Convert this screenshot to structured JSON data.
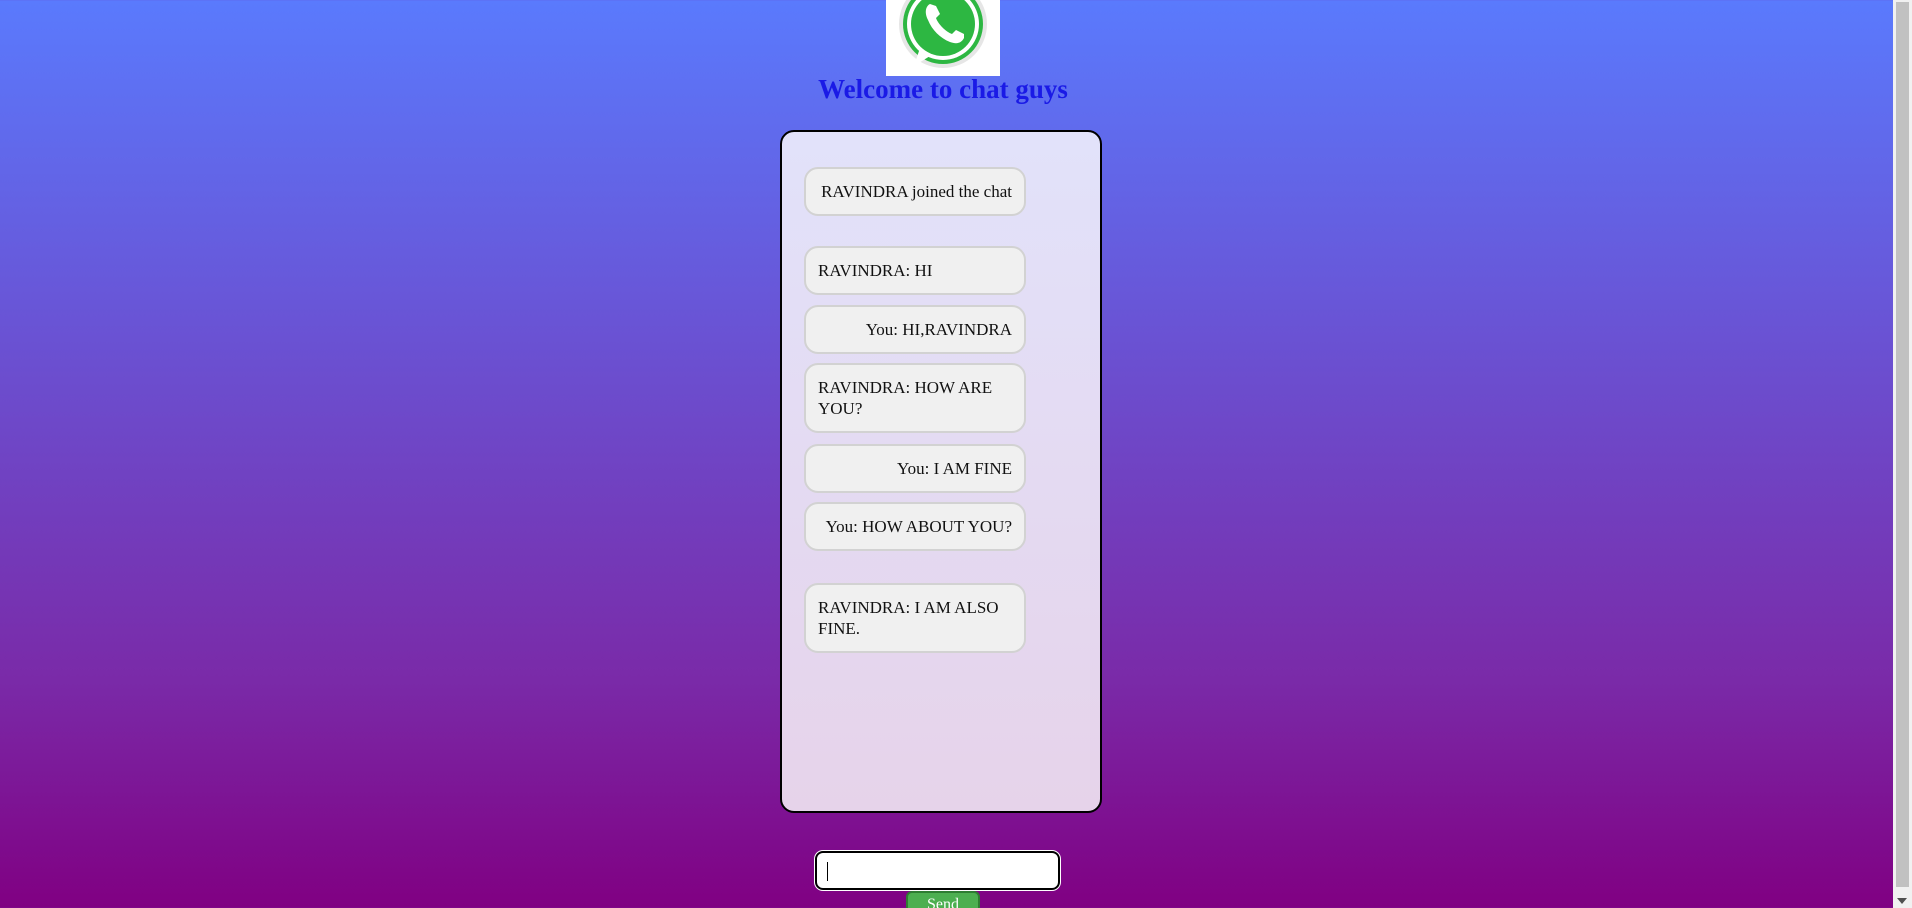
{
  "header": {
    "logo_icon": "whatsapp-icon",
    "title": "Welcome to chat guys"
  },
  "messages": [
    {
      "text": "RAVINDRA joined the chat",
      "align": "right"
    },
    {
      "text": "RAVINDRA: HI",
      "align": "left"
    },
    {
      "text": "You: HI,RAVINDRA",
      "align": "right"
    },
    {
      "text": "RAVINDRA: HOW ARE YOU?",
      "align": "left"
    },
    {
      "text": "You: I AM FINE",
      "align": "right"
    },
    {
      "text": "You: HOW ABOUT YOU?",
      "align": "right"
    },
    {
      "text": "RAVINDRA: I AM ALSO FINE.",
      "align": "left"
    }
  ],
  "composer": {
    "input_value": "",
    "send_label": "Send"
  },
  "colors": {
    "title": "#1a1ae6",
    "send_button": "#4caf50",
    "background_top": "#5a7afd",
    "background_bottom": "#800082"
  }
}
